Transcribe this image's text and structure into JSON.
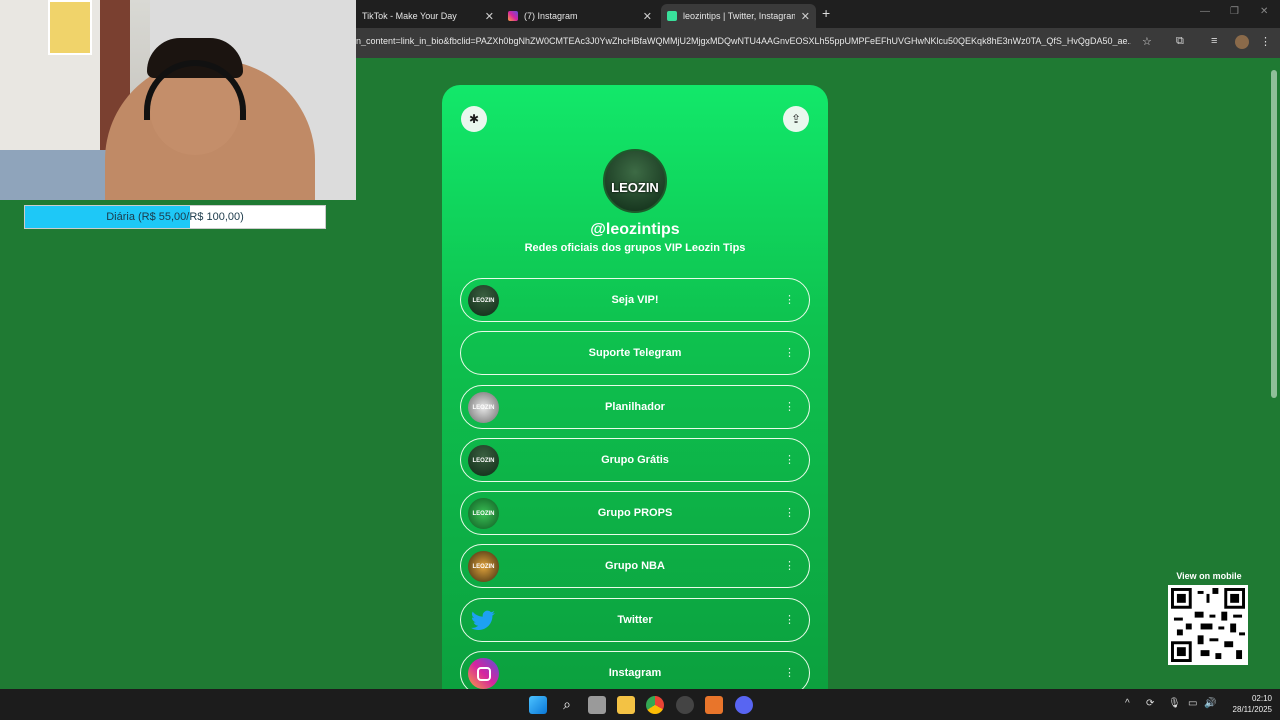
{
  "browser": {
    "tabs": [
      {
        "title": "TikTok - Make Your Day",
        "favicon_color": "#111111"
      },
      {
        "title": "(7) Instagram",
        "favicon_color": "#d6249f"
      },
      {
        "title": "leozintips | Twitter, Instagram, Y",
        "favicon_color": "#39e09b"
      }
    ],
    "url": "n_content=link_in_bio&fbclid=PAZXh0bgNhZW0CMTEAc3J0YwZhcHBfaWQMMjU2MjgxMDQwNTU4AAGnvEOSXLh55ppUMPFeEFhUVGHwNKlcu50QEKqk8hE3nWz0TA_QfS_HvQgDA50_ae..."
  },
  "stream": {
    "goal_text": "Diária (R$ 55,00/R$ 100,00)",
    "goal_fraction": 0.55,
    "goal_color": "#1ec8f7"
  },
  "profile": {
    "avatar_text": "LEOZIN",
    "handle": "@leozintips",
    "bio": "Redes oficiais dos grupos VIP Leozin Tips"
  },
  "links": [
    {
      "label": "Seja VIP!",
      "thumb": "LEOZIN",
      "icon": "avatar"
    },
    {
      "label": "Suporte Telegram",
      "thumb": "",
      "icon": "none"
    },
    {
      "label": "Planilhador",
      "thumb": "LEOZIN",
      "icon": "avatar"
    },
    {
      "label": "Grupo Grátis",
      "thumb": "LEOZIN",
      "icon": "avatar"
    },
    {
      "label": "Grupo PROPS",
      "thumb": "LEOZIN",
      "icon": "avatar"
    },
    {
      "label": "Grupo NBA",
      "thumb": "LEOZIN",
      "icon": "avatar"
    },
    {
      "label": "Twitter",
      "thumb": "",
      "icon": "twitter-icon"
    },
    {
      "label": "Instagram",
      "thumb": "",
      "icon": "instagram-icon"
    }
  ],
  "qr": {
    "label": "View on mobile"
  },
  "taskbar": {
    "time": "02:10",
    "date": "28/11/2025"
  },
  "colors": {
    "background": "#1f7a33",
    "card_top": "#12e86a",
    "card_bottom": "#0ca03e"
  }
}
